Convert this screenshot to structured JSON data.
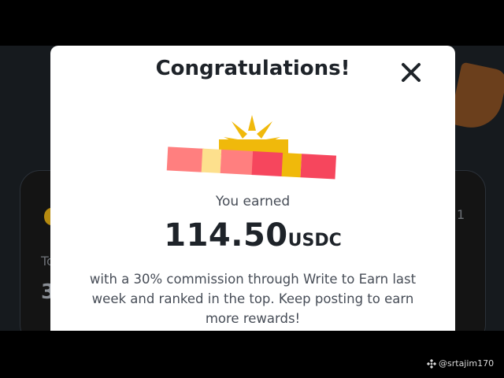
{
  "modal": {
    "title": "Congratulations!",
    "earned_label": "You earned",
    "amount": "114.50",
    "currency": "USDC",
    "message": "with a 30% commission through Write to Earn last week and ranked in the top. Keep posting to earn more rewards!"
  },
  "background": {
    "card_label_fragment": "To",
    "card_value_fragment": "3",
    "card_right_fragment": "1"
  },
  "watermark": {
    "text": "@srtajim170",
    "icon": "binance-logo-icon"
  },
  "colors": {
    "accent_yellow": "#f0b90b",
    "gift_red": "#f6465d",
    "gift_pink": "#ff7f7f",
    "text_primary": "#1e2329",
    "text_secondary": "#474d57"
  }
}
